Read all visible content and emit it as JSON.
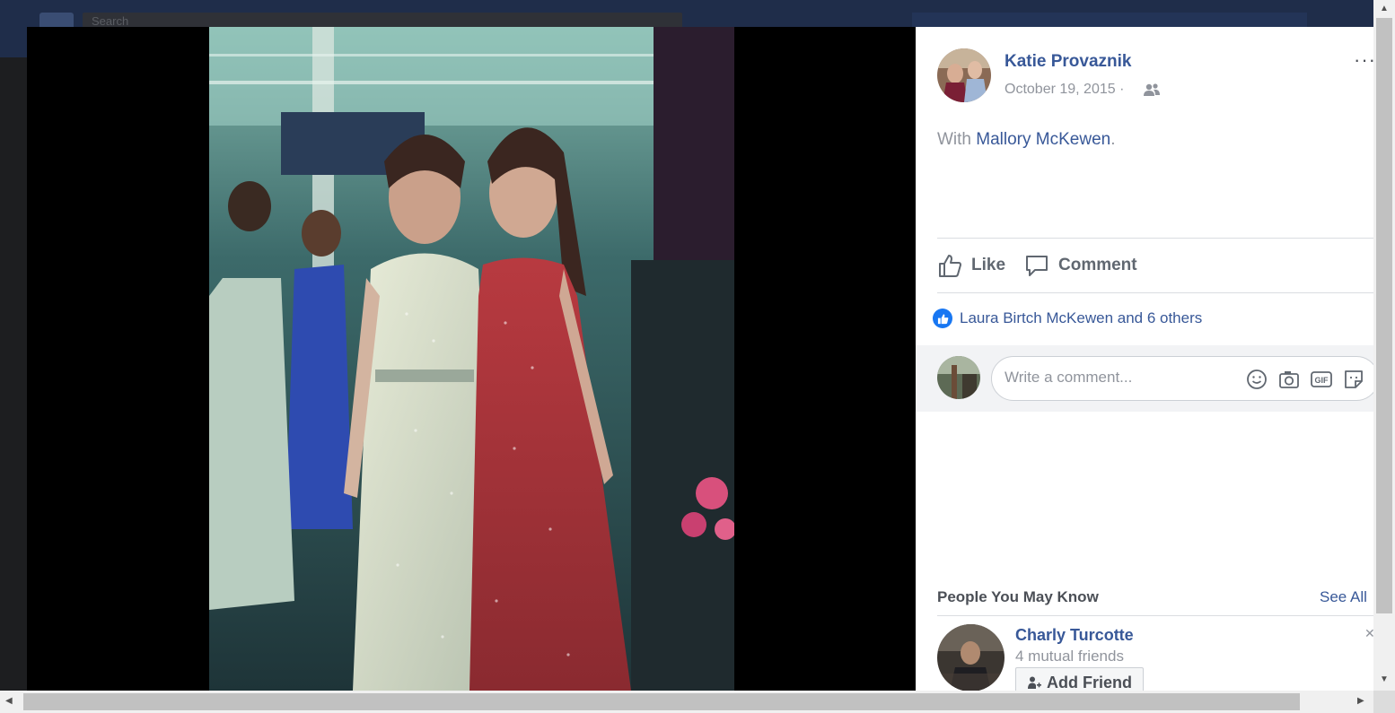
{
  "background": {
    "search_placeholder": "Search"
  },
  "post": {
    "author": "Katie Provaznik",
    "date": "October 19, 2015 ·",
    "audience_icon": "friends-icon",
    "more_label": "···",
    "with_prefix": "With",
    "tagged_person": "Mallory McKewen",
    "with_suffix": "."
  },
  "actions": {
    "like_label": "Like",
    "comment_label": "Comment"
  },
  "reactions": {
    "summary": "Laura Birtch McKewen and 6 others"
  },
  "comment": {
    "placeholder": "Write a comment...",
    "icons": [
      "emoji-icon",
      "camera-icon",
      "gif-icon",
      "sticker-icon"
    ]
  },
  "people_you_may_know": {
    "title": "People You May Know",
    "see_all": "See All",
    "people": [
      {
        "name": "Charly Turcotte",
        "mutual": "4 mutual friends",
        "add_label": "Add Friend"
      }
    ]
  },
  "colors": {
    "link": "#385898",
    "like_blue": "#1877f2",
    "overlay_black": "#000000"
  }
}
